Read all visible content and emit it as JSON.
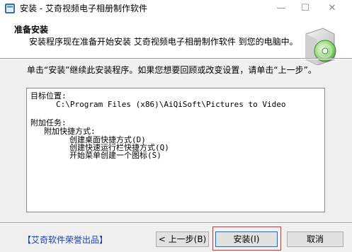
{
  "window": {
    "title": "安装 - 艾奇视频电子相册制作软件",
    "controls": {
      "minimize": "—",
      "maximize": "☐",
      "close": "✕"
    }
  },
  "header": {
    "title": "准备安装",
    "subtitle": "安装程序现在准备开始安装 艾奇视频电子相册制作软件 到您的电脑中。"
  },
  "instruction": "单击“安装”继续此安装程序。如果您想要回顾或改变设置，请单击“上一步”。",
  "summary": {
    "target_label": "目标位置:",
    "target_path": "C:\\Program Files (x86)\\AiQiSoft\\Pictures to Video",
    "tasks_label": "附加任务:",
    "shortcuts_label": "附加快捷方式:",
    "tasks": [
      "创建桌面快捷方式(D)",
      "创建快速运行栏快捷方式(Q)",
      "开始菜单创建一个图标(S)"
    ]
  },
  "footer": {
    "brand": "【艾奇软件荣誉出品】",
    "back_label": "< 上一步(B)",
    "install_label": "安装(I)",
    "cancel_label": "取消"
  },
  "colors": {
    "header_bg": "#ffffff",
    "dialog_bg": "#f0f0f0",
    "brand_text": "#1a3fb5",
    "focus_outline": "#e03030"
  }
}
